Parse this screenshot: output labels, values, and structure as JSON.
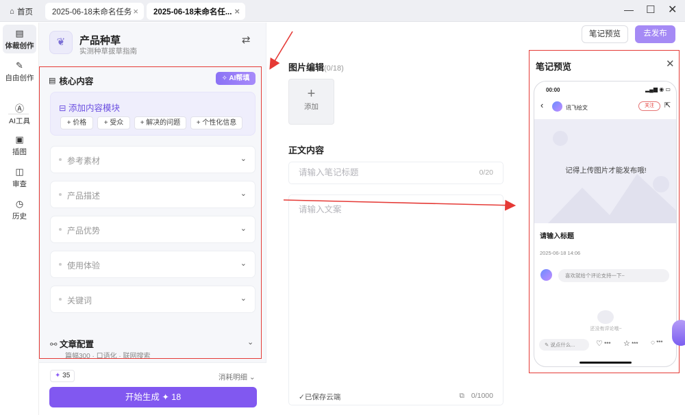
{
  "tabs": {
    "home": "首页",
    "tab1": "2025-06-18未命名任务",
    "tab2": "2025-06-18未命名任..."
  },
  "nav": [
    {
      "label": "体裁创作"
    },
    {
      "label": "自由创作"
    },
    {
      "label": "AI工具"
    },
    {
      "label": "插图"
    },
    {
      "label": "审查"
    },
    {
      "label": "历史"
    }
  ],
  "panel": {
    "title": "产品种草",
    "subtitle": "实测种草拔草指南",
    "core_title": "核心内容",
    "ai_help": "AI帮填",
    "add_module": "添加内容模块",
    "chips": [
      "+ 价格",
      "+ 受众",
      "+ 解决的问题",
      "+ 个性化信息"
    ],
    "sections": [
      "参考素材",
      "产品描述",
      "产品优势",
      "使用体验",
      "关键词"
    ],
    "config_title": "文章配置",
    "config_sub": "篇幅300 · 口语化 · 联网搜索",
    "coins": "35",
    "consume": "消耗明细",
    "generate": "开始生成",
    "generate_cost": "18"
  },
  "editor": {
    "preview_btn": "笔记预览",
    "publish_btn": "去发布",
    "image_title": "图片编辑",
    "image_count": "(0/18)",
    "add_label": "添加",
    "body_title": "正文内容",
    "title_placeholder": "请输入笔记标题",
    "title_count": "0/20",
    "body_placeholder": "请输入文案",
    "saved": "已保存云端",
    "body_count": "0/1000"
  },
  "preview": {
    "title": "笔记预览",
    "time": "00:00",
    "account": "讯飞绘文",
    "follow": "关注",
    "image_msg": "记得上传图片才能发布哦!",
    "note_title": "请输入标题",
    "date": "2025-06-18 14:06",
    "comment_placeholder": "喜欢就给个评论支持一下~",
    "empty": "还没有评论哦~",
    "say": "说点什么...",
    "like": "***",
    "star": "***",
    "comment": "***"
  }
}
